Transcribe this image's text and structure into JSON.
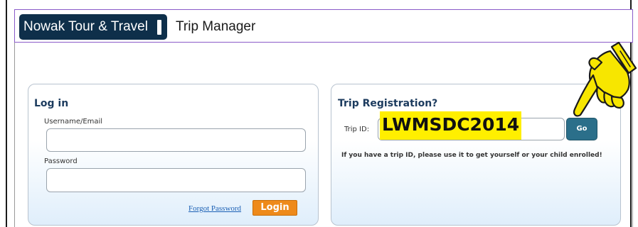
{
  "header": {
    "brand": "Nowak Tour & Travel",
    "app_title": "Trip Manager"
  },
  "login": {
    "title": "Log in",
    "username_label": "Username/Email",
    "username_value": "",
    "password_label": "Password",
    "password_value": "",
    "forgot_label": "Forgot Password",
    "login_label": "Login"
  },
  "trip": {
    "title": "Trip Registration?",
    "id_label": "Trip ID:",
    "id_value": "LWMSDC2014",
    "go_label": "Go",
    "info": "If you have a trip ID, please use it to get yourself or your child enrolled!"
  },
  "annotation": {
    "icon": "pointing-hand-icon",
    "highlight_color": "#ffef00"
  },
  "colors": {
    "brand_bg": "#0e2f4a",
    "login_button": "#ee8a1a",
    "go_button": "#2b6f8a"
  }
}
